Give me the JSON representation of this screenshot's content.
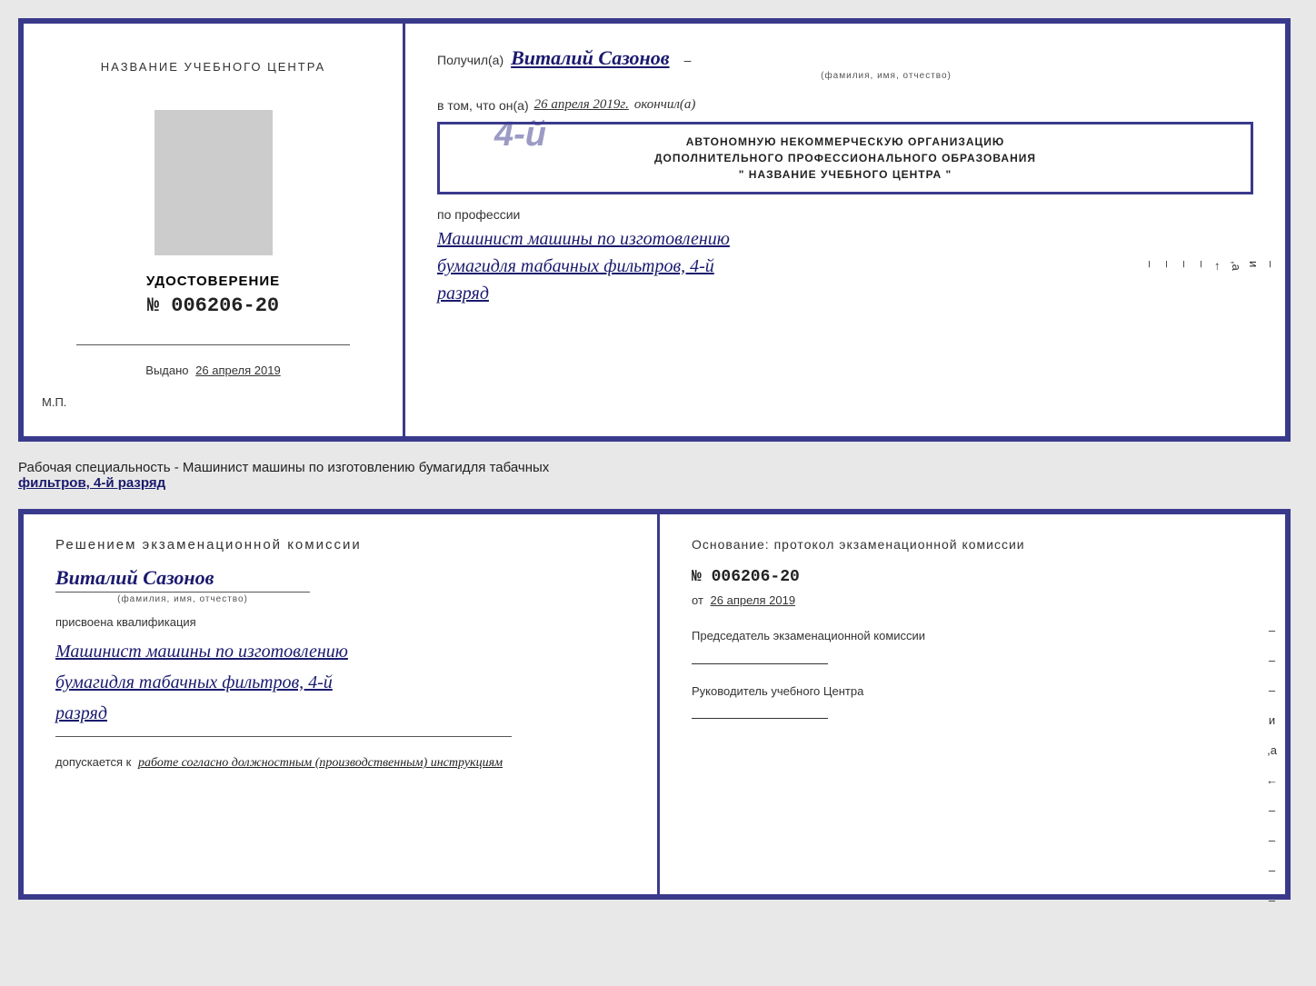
{
  "top_doc": {
    "left": {
      "heading": "НАЗВАНИЕ УЧЕБНОГО ЦЕНТРА",
      "photo_alt": "фото",
      "udostoverenie_label": "УДОСТОВЕРЕНИЕ",
      "number": "№ 006206-20",
      "vydano_label": "Выдано",
      "vydano_date": "26 апреля 2019",
      "mp_label": "М.П."
    },
    "right": {
      "poluchil_prefix": "Получил(а)",
      "name_handwritten": "Виталий Сазонов",
      "fio_label": "(фамилия, имя, отчество)",
      "vtom_prefix": "в том, что он(а)",
      "date_handwritten": "26 апреля 2019г.",
      "okoncil": "окончил(а)",
      "stamp_line1": "АВТОНОМНУЮ НЕКОММЕРЧЕСКУЮ ОРГАНИЗАЦИЮ",
      "stamp_line2": "ДОПОЛНИТЕЛЬНОГО ПРОФЕССИОНАЛЬНОГО ОБРАЗОВАНИЯ",
      "stamp_line3": "\" НАЗВАНИЕ УЧЕБНОГО ЦЕНТРА \"",
      "stamp_overlay": "4-й",
      "poprofessii": "по профессии",
      "profession1": "Машинист машины по изготовлению",
      "profession2": "бумагидля табачных фильтров, 4-й",
      "profession3": "разряд",
      "right_letters": [
        "–",
        "и",
        "а",
        "←",
        "–",
        "–",
        "–",
        "–"
      ]
    }
  },
  "middle": {
    "text": "Рабочая специальность - Машинист машины по изготовлению бумагидля табачных",
    "text2_underlined": "фильтров, 4-й разряд"
  },
  "bottom_doc": {
    "left": {
      "resheniem": "Решением экзаменационной комиссии",
      "name_handwritten": "Виталий Сазонов",
      "fio_label": "(фамилия, имя, отчество)",
      "prisvoena": "присвоена квалификация",
      "qual1": "Машинист машины по изготовлению",
      "qual2": "бумагидля табачных фильтров, 4-й",
      "qual3": "разряд",
      "dopuskaetsya": "допускается к",
      "dopuskaetsya_value": "работе согласно должностным (производственным) инструкциям"
    },
    "right": {
      "osnovanie": "Основание: протокол экзаменационной комиссии",
      "number": "№ 006206-20",
      "ot_prefix": "от",
      "ot_date": "26 апреля 2019",
      "predsedatel_label": "Председатель экзаменационной комиссии",
      "rukovoditel_label": "Руководитель учебного Центра",
      "right_letters": [
        "–",
        "–",
        "–",
        "и",
        "а",
        "←",
        "–",
        "–",
        "–",
        "–"
      ]
    }
  }
}
